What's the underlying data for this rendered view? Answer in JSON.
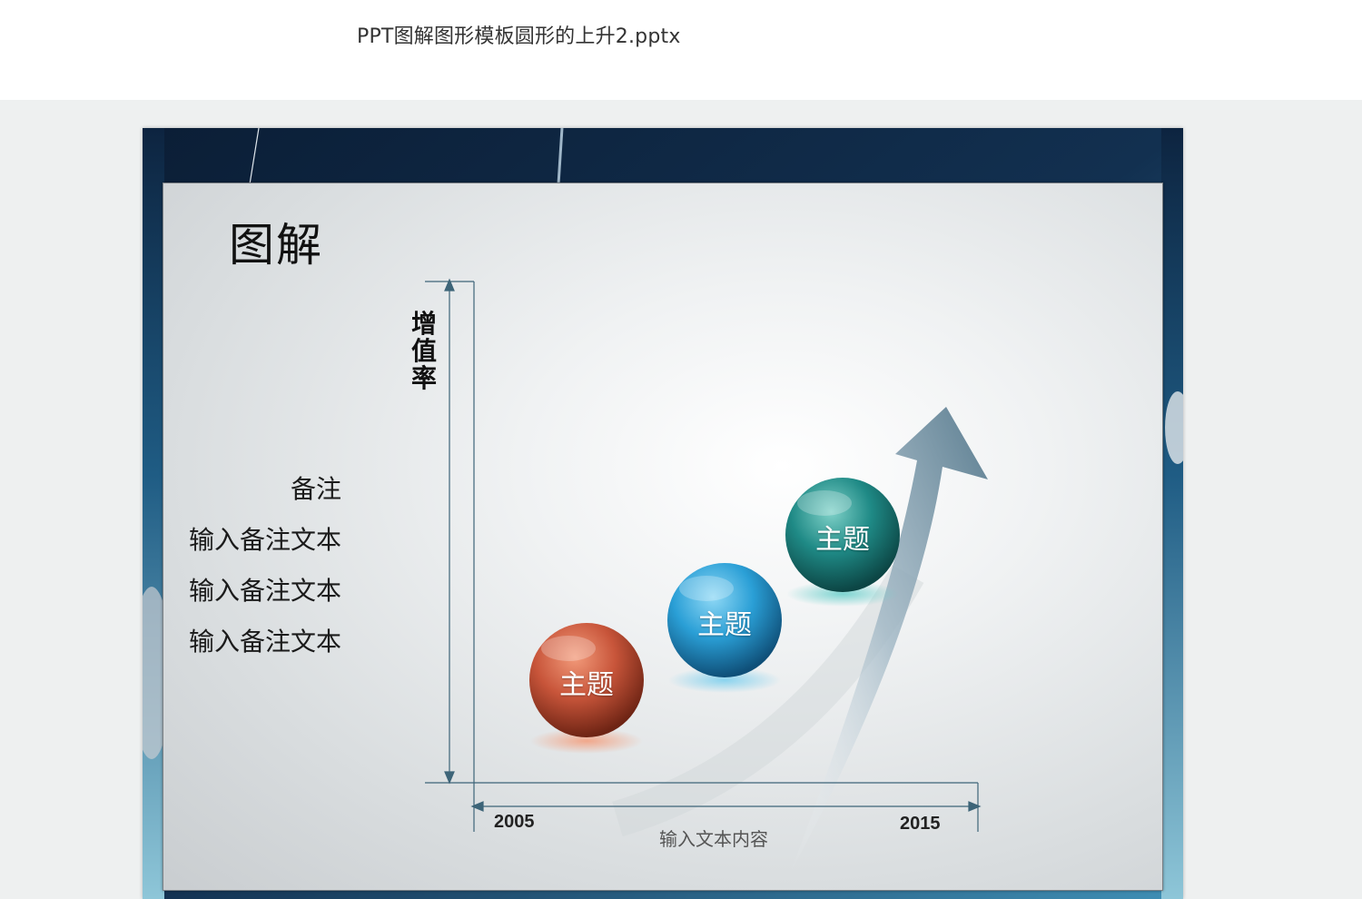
{
  "file": {
    "title": "PPT图解图形模板圆形的上升2.pptx"
  },
  "slide": {
    "title": "图解",
    "notes": {
      "heading": "备注",
      "lines": [
        "输入备注文本",
        "输入备注文本",
        "输入备注文本"
      ]
    },
    "y_axis_label": "增值率",
    "x_axis": {
      "start_label": "2005",
      "end_label": "2015",
      "caption": "输入文本内容"
    },
    "spheres": [
      {
        "label": "主题",
        "color": "#c8553a"
      },
      {
        "label": "主题",
        "color": "#2a9fd6"
      },
      {
        "label": "主题",
        "color": "#1f8a86"
      }
    ],
    "colors": {
      "frame": "#0e2540",
      "axis": "#3d6478",
      "arrow": "#5b7d90"
    }
  }
}
